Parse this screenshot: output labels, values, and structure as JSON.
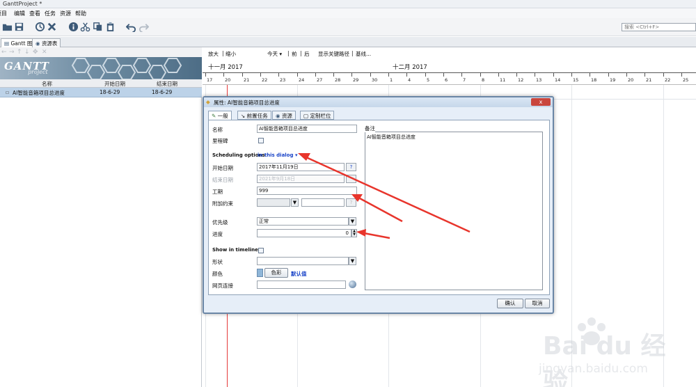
{
  "window": {
    "title": "GanttProject *"
  },
  "menu": [
    "项目",
    "编辑",
    "查看",
    "任务",
    "资源",
    "帮助"
  ],
  "search": {
    "placeholder": "搜索 <Ctrl+F>"
  },
  "tabs": [
    "Gantt 图",
    "资源表"
  ],
  "logo": {
    "main": "GANTT",
    "sub": "project"
  },
  "task_table": {
    "columns": [
      "名称",
      "开始日期",
      "结束日期"
    ],
    "rows": [
      {
        "name": "AI智能音箱项目总进度",
        "start": "18-6-29",
        "end": "18-6-29"
      }
    ]
  },
  "chart_nav": {
    "zoom_in": "放大",
    "zoom_out": "缩小",
    "today": "今天 ▾",
    "prev": "前",
    "next": "后",
    "critical_path": "显示关键路径",
    "baseline": "基线..."
  },
  "months": [
    "十一月 2017",
    "十二月 2017"
  ],
  "days": [
    "17",
    "20",
    "21",
    "22",
    "23",
    "24",
    "27",
    "28",
    "29",
    "30",
    "1",
    "4",
    "5",
    "6",
    "7",
    "8",
    "11",
    "12",
    "13",
    "14",
    "15",
    "18",
    "19",
    "20",
    "21",
    "22",
    "25"
  ],
  "dialog": {
    "title": "属性: AI智能音箱项目总进度",
    "close": "x",
    "tabs": [
      "一般",
      "前置任务",
      "资源",
      "定制栏位"
    ],
    "name_label": "名称",
    "name_value": "AI智能音箱项目总进度",
    "milestone_label": "里程碑",
    "scheduling_label": "Scheduling options",
    "scheduling_link": "in this dialog ▾",
    "start_label": "开始日期",
    "start_value": "2017年11月19日",
    "end_label": "结束日期",
    "end_value": "2021年9月18日",
    "duration_label": "工期",
    "duration_value": "999",
    "constraint_label": "附加约束",
    "priority_label": "优先级",
    "priority_value": "正常",
    "progress_label": "进度",
    "progress_value": "0",
    "timeline_label": "Show in timeline",
    "shape_label": "形状",
    "color_label": "颜色",
    "color_button": "色彩",
    "color_default": "默认值",
    "weblink_label": "网页连接",
    "notes_label": "备注",
    "notes_value": "AI智能音箱项目总进度",
    "ok": "确认",
    "cancel": "取消"
  },
  "watermark": {
    "brand": "Bai du 经验",
    "url": "jingyan.baidu.com"
  },
  "colors": {
    "accent_red": "#e53a3a",
    "row_selected": "#bcd2e8",
    "dialog_border": "#6a86a6"
  }
}
